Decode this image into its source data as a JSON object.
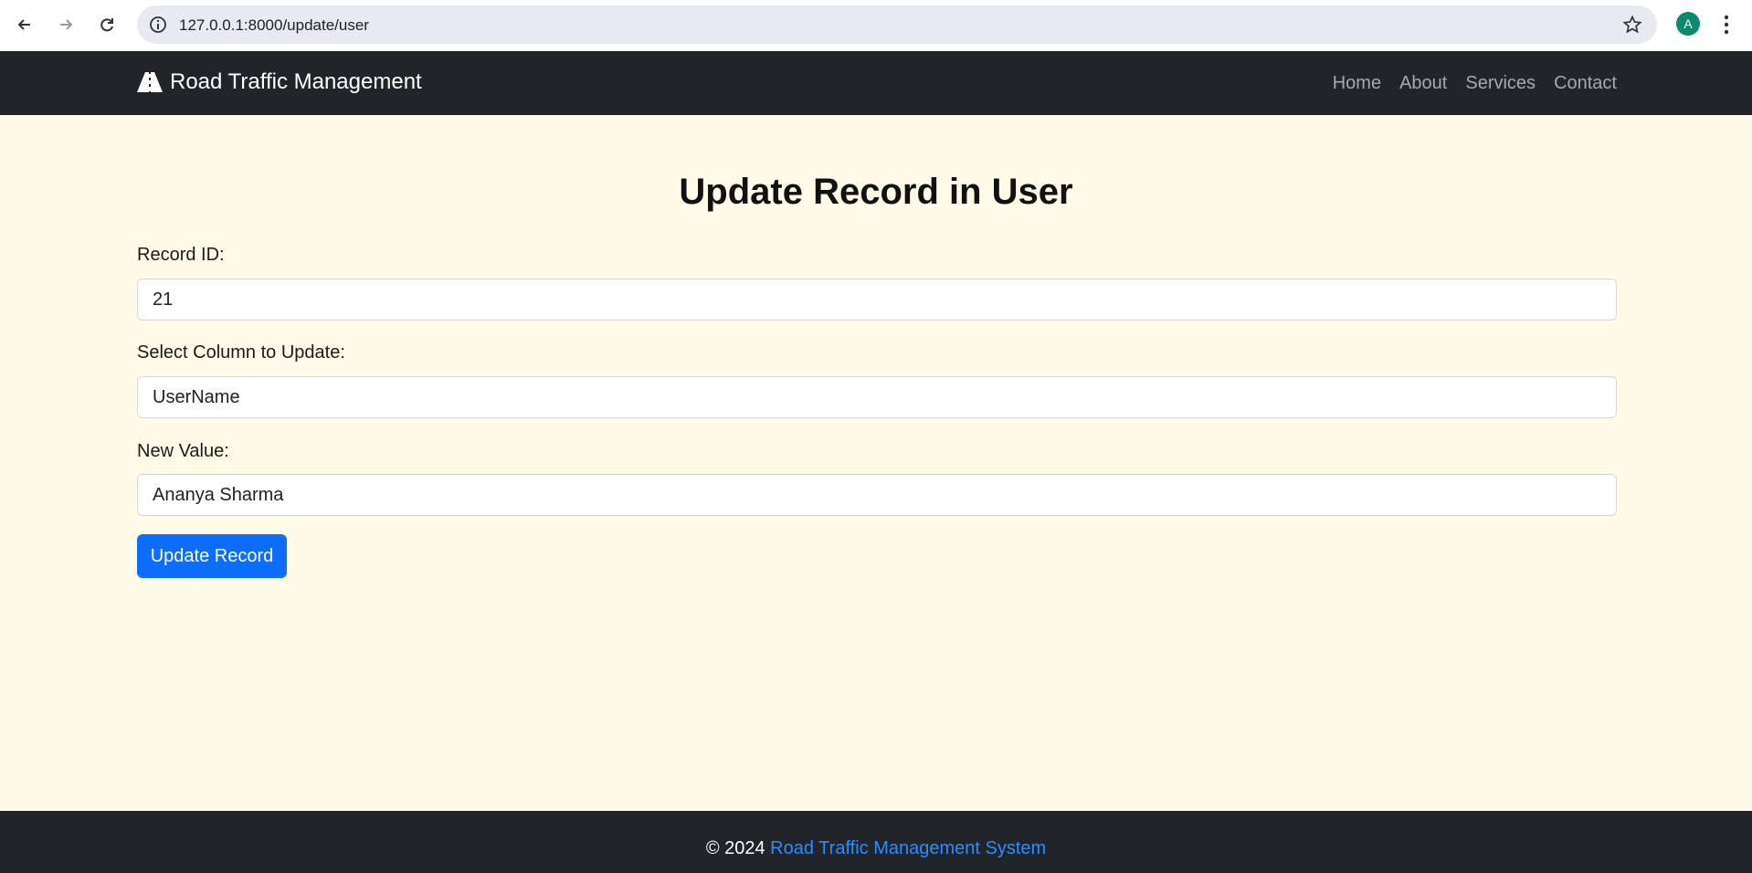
{
  "browser": {
    "url": "127.0.0.1:8000/update/user",
    "profile_initial": "A"
  },
  "navbar": {
    "brand": "Road Traffic Management",
    "links": [
      "Home",
      "About",
      "Services",
      "Contact"
    ]
  },
  "form": {
    "title": "Update Record in User",
    "record_id_label": "Record ID:",
    "record_id_value": "21",
    "column_label": "Select Column to Update:",
    "column_value": "UserName",
    "new_value_label": "New Value:",
    "new_value_value": "Ananya Sharma",
    "submit_label": "Update Record"
  },
  "footer": {
    "copyright": "© 2024",
    "link_text": "Road Traffic Management System"
  },
  "colors": {
    "navbar_bg": "#212529",
    "page_bg": "#fffbe8",
    "primary": "#0d6efd"
  }
}
